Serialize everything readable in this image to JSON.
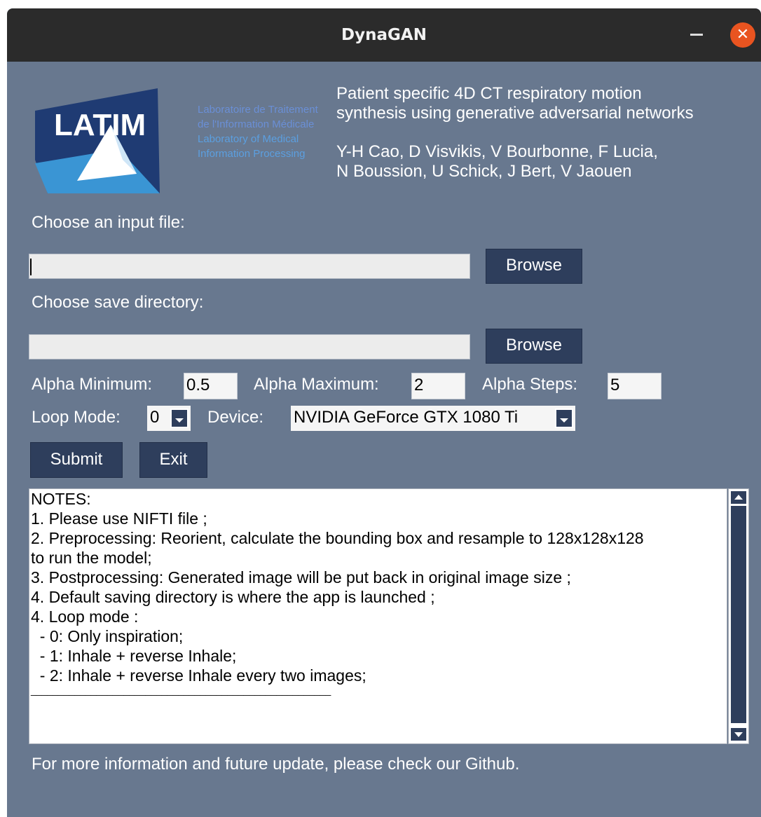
{
  "window": {
    "title": "DynaGAN"
  },
  "logo": {
    "acronym": "LATIM",
    "lines": [
      "Laboratoire de Traitement",
      "de l'Information Médicale",
      "Laboratory of Medical",
      "Information Processing"
    ]
  },
  "header": {
    "title_line1": "Patient specific 4D CT respiratory motion",
    "title_line2": "synthesis using generative adversarial networks",
    "authors_line1": "Y-H Cao, D Visvikis, V Bourbonne, F Lucia,",
    "authors_line2": "N Boussion, U Schick, J Bert, V Jaouen"
  },
  "input_file": {
    "label": "Choose an input file:",
    "value": "",
    "browse_label": "Browse"
  },
  "save_dir": {
    "label": "Choose save directory:",
    "value": "",
    "browse_label": "Browse"
  },
  "params": {
    "alpha_min_label": "Alpha Minimum:",
    "alpha_min_value": "0.5",
    "alpha_max_label": "Alpha Maximum:",
    "alpha_max_value": "2",
    "alpha_steps_label": "Alpha Steps:",
    "alpha_steps_value": "5",
    "loop_mode_label": "Loop Mode:",
    "loop_mode_value": "0",
    "device_label": "Device:",
    "device_value": "NVIDIA GeForce GTX 1080 Ti"
  },
  "actions": {
    "submit_label": "Submit",
    "exit_label": "Exit"
  },
  "notes": {
    "lines": [
      "NOTES:",
      "",
      "1. Please use NIFTI file ;",
      "2. Preprocessing: Reorient, calculate the bounding box and resample to 128x128x128",
      "to run the model;",
      "3. Postprocessing: Generated image will be put back in original image size ;",
      "4. Default saving directory is where the app is launched ;",
      "4. Loop mode :",
      "  - 0: Only inspiration;",
      "  - 1: Inhale + reverse Inhale;",
      "  - 2: Inhale + reverse Inhale every two images;",
      "_______________________________________________________"
    ]
  },
  "footer": {
    "text": "For more information and future update, please check our Github."
  },
  "colors": {
    "window_bg": "#68788f",
    "titlebar_bg": "#2b2b2b",
    "button_bg": "#2e3e5c",
    "close_button": "#e95420",
    "logo_blue": "#2f7fc1",
    "logo_navy": "#1f3b73"
  },
  "icons": {
    "close": "close-icon",
    "minimize": "minimize-icon",
    "dropdown": "chevron-down-icon",
    "scroll_up": "arrow-up-icon",
    "scroll_down": "arrow-down-icon"
  }
}
